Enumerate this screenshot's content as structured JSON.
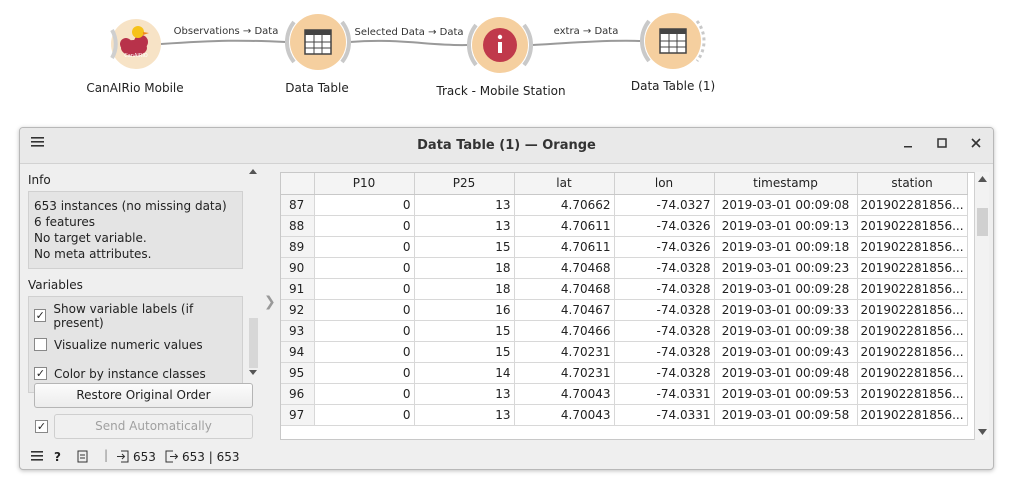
{
  "canvas": {
    "nodes": [
      {
        "label": "CanAIRio Mobile",
        "icon": "duck-cloud-icon"
      },
      {
        "label": "Data Table",
        "icon": "table-icon"
      },
      {
        "label": "Track - Mobile Station",
        "icon": "info-icon"
      },
      {
        "label": "Data Table (1)",
        "icon": "table-icon"
      }
    ],
    "links": [
      {
        "label": "Observations → Data"
      },
      {
        "label": "Selected Data → Data"
      },
      {
        "label": "extra → Data"
      }
    ],
    "colors": {
      "node_fill": "#fbe6c8",
      "node_ring": "#d0d0d0",
      "info_red": "#c0394b",
      "table_orange": "#f5cf9f"
    }
  },
  "window": {
    "title": "Data Table (1) — Orange",
    "menu_icon": "hamburger-icon",
    "minimize_icon": "minimize-icon",
    "maximize_icon": "maximize-icon",
    "close_icon": "close-icon"
  },
  "info": {
    "title": "Info",
    "lines": [
      "653 instances (no missing data)",
      "6 features",
      "No target variable.",
      "No meta attributes."
    ]
  },
  "variables": {
    "title": "Variables",
    "options": [
      {
        "label": "Show variable labels (if present)",
        "checked": true
      },
      {
        "label": "Visualize numeric values",
        "checked": false
      },
      {
        "label": "Color by instance classes",
        "checked": true
      }
    ]
  },
  "buttons": {
    "restore": "Restore Original Order",
    "send_auto": "Send Automatically",
    "send_auto_checked": true
  },
  "table": {
    "columns": [
      "",
      "P10",
      "P25",
      "lat",
      "lon",
      "timestamp",
      "station"
    ],
    "rows": [
      [
        "87",
        "0",
        "13",
        "4.70662",
        "-74.0327",
        "2019-03-01 00:09:08",
        "201902281856..."
      ],
      [
        "88",
        "0",
        "13",
        "4.70611",
        "-74.0326",
        "2019-03-01 00:09:13",
        "201902281856..."
      ],
      [
        "89",
        "0",
        "15",
        "4.70611",
        "-74.0326",
        "2019-03-01 00:09:18",
        "201902281856..."
      ],
      [
        "90",
        "0",
        "18",
        "4.70468",
        "-74.0328",
        "2019-03-01 00:09:23",
        "201902281856..."
      ],
      [
        "91",
        "0",
        "18",
        "4.70468",
        "-74.0328",
        "2019-03-01 00:09:28",
        "201902281856..."
      ],
      [
        "92",
        "0",
        "16",
        "4.70467",
        "-74.0328",
        "2019-03-01 00:09:33",
        "201902281856..."
      ],
      [
        "93",
        "0",
        "15",
        "4.70466",
        "-74.0328",
        "2019-03-01 00:09:38",
        "201902281856..."
      ],
      [
        "94",
        "0",
        "15",
        "4.70231",
        "-74.0328",
        "2019-03-01 00:09:43",
        "201902281856..."
      ],
      [
        "95",
        "0",
        "14",
        "4.70231",
        "-74.0328",
        "2019-03-01 00:09:48",
        "201902281856..."
      ],
      [
        "96",
        "0",
        "13",
        "4.70043",
        "-74.0331",
        "2019-03-01 00:09:53",
        "201902281856..."
      ],
      [
        "97",
        "0",
        "13",
        "4.70043",
        "-74.0331",
        "2019-03-01 00:09:58",
        "201902281856..."
      ]
    ]
  },
  "statusbar": {
    "input_count": "653",
    "output_count": "653 | 653"
  }
}
